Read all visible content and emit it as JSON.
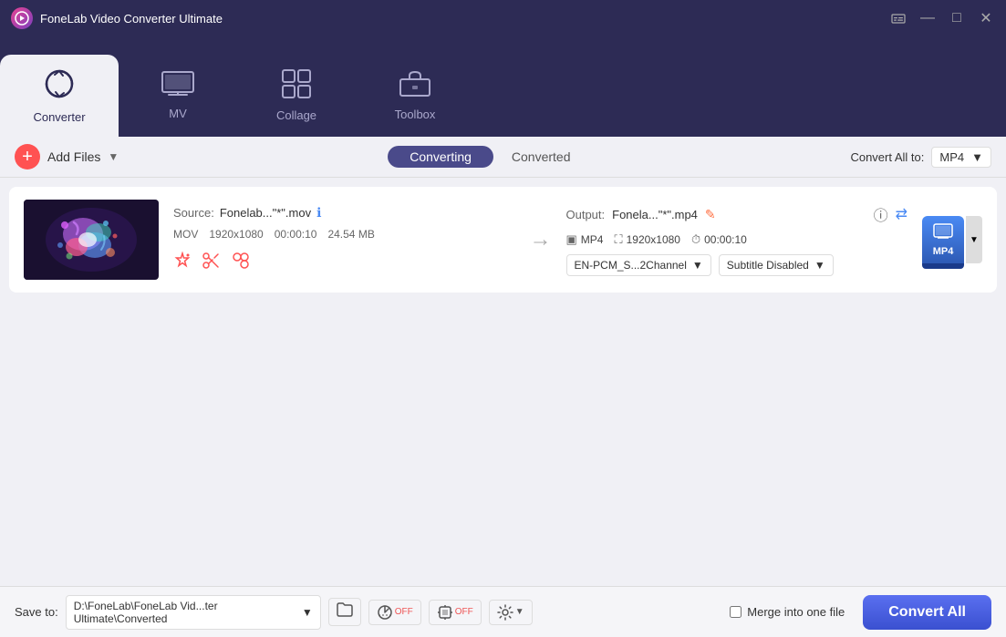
{
  "app": {
    "title": "FoneLab Video Converter Ultimate",
    "icon": "▶"
  },
  "titlebar": {
    "captions_btn": "⊟",
    "minimize_btn": "—",
    "maximize_btn": "□",
    "close_btn": "✕"
  },
  "nav": {
    "tabs": [
      {
        "id": "converter",
        "label": "Converter",
        "icon": "🔄",
        "active": true
      },
      {
        "id": "mv",
        "label": "MV",
        "icon": "📺",
        "active": false
      },
      {
        "id": "collage",
        "label": "Collage",
        "icon": "⊞",
        "active": false
      },
      {
        "id": "toolbox",
        "label": "Toolbox",
        "icon": "🧰",
        "active": false
      }
    ]
  },
  "toolbar": {
    "add_files_label": "Add Files",
    "converting_label": "Converting",
    "converted_label": "Converted",
    "convert_all_to_label": "Convert All to:",
    "format": "MP4"
  },
  "file_item": {
    "source_label": "Source:",
    "source_name": "Fonelab...\"*\".mov",
    "format": "MOV",
    "resolution": "1920x1080",
    "duration": "00:00:10",
    "size": "24.54 MB",
    "output_label": "Output:",
    "output_name": "Fonela...\"*\".mp4",
    "out_format": "MP4",
    "out_resolution": "1920x1080",
    "out_duration": "00:00:10",
    "audio_track": "EN-PCM_S...2Channel",
    "subtitle": "Subtitle Disabled",
    "format_badge": "MP4"
  },
  "statusbar": {
    "save_to_label": "Save to:",
    "save_path": "D:\\FoneLab\\FoneLab Vid...ter Ultimate\\Converted",
    "merge_label": "Merge into one file",
    "convert_all_btn": "Convert All"
  }
}
